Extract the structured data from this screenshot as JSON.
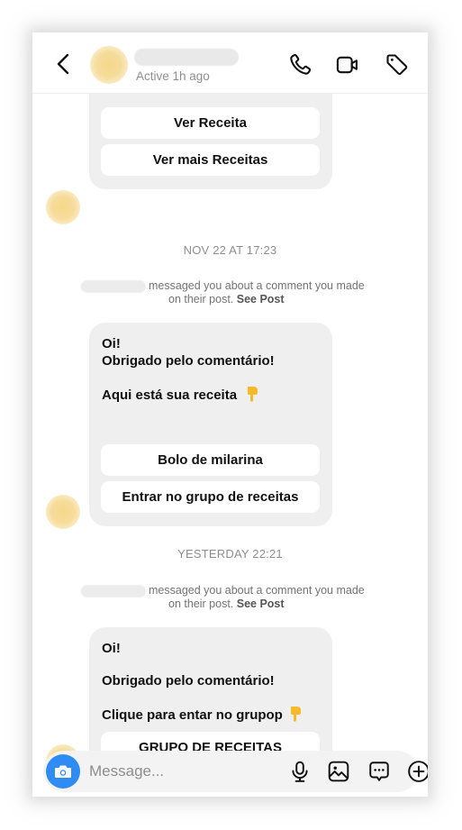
{
  "header": {
    "status": "Active 1h ago",
    "icons": [
      "back-chevron-icon",
      "phone-icon",
      "video-camera-icon",
      "tag-icon"
    ]
  },
  "thread": [
    {
      "type": "bubble",
      "buttons": [
        "Ver Receita",
        "Ver mais Receitas"
      ]
    },
    {
      "type": "date",
      "label": "NOV 22 AT 17:23"
    },
    {
      "type": "notice",
      "line1": "messaged you about a comment you made",
      "line2": "on their post.",
      "link": "See Post"
    },
    {
      "type": "bubble",
      "lines": [
        "Oi!",
        "Obrigado pelo comentário!",
        "Aqui está sua receita"
      ],
      "buttons": [
        "Bolo de milarina",
        "Entrar no grupo de receitas"
      ]
    },
    {
      "type": "date",
      "label": "YESTERDAY 22:21"
    },
    {
      "type": "notice",
      "line1": "messaged you about a comment you made",
      "line2": "on their post.",
      "link": "See Post"
    },
    {
      "type": "bubble",
      "lines": [
        "Oi!",
        "Obrigado pelo comentário!",
        "Clique para entar no grupop"
      ],
      "buttons": [
        "GRUPO DE RECEITAS"
      ]
    }
  ],
  "composer": {
    "placeholder": "Message...",
    "value": "",
    "icons": [
      "camera-icon",
      "microphone-icon",
      "gallery-icon",
      "sticker-chat-icon",
      "plus-circle-icon"
    ]
  },
  "colors": {
    "accent": "#2f8cf3",
    "bubble": "#efefef",
    "muted_text": "#8e8e8e",
    "emoji": "#f7b928"
  }
}
